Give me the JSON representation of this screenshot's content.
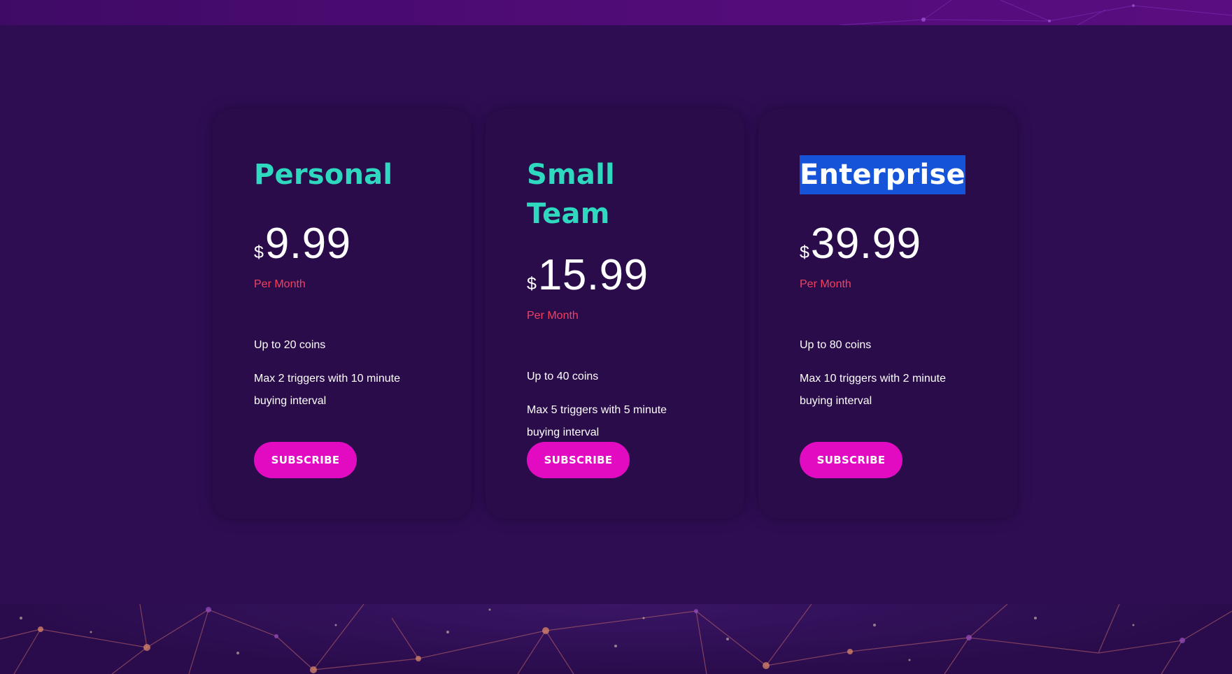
{
  "plans": [
    {
      "name": "Personal",
      "currency": "$",
      "price": "9.99",
      "period": "Per Month",
      "features": [
        "Up to 20 coins",
        "Max 2 triggers with 10 minute buying interval"
      ],
      "button": "SUBSCRIBE"
    },
    {
      "name": "Small Team",
      "currency": "$",
      "price": "15.99",
      "period": "Per Month",
      "features": [
        "Up to 40 coins",
        "Max 5 triggers with 5 minute buying interval"
      ],
      "button": "SUBSCRIBE"
    },
    {
      "name": "Enterprise",
      "currency": "$",
      "price": "39.99",
      "period": "Per Month",
      "features": [
        "Up to 80 coins",
        "Max 10 triggers with 2 minute buying interval"
      ],
      "button": "SUBSCRIBE",
      "selected": true
    }
  ],
  "colors": {
    "background": "#2f0d53",
    "card": "#2a0c4b",
    "plan_name": "#2ed9bf",
    "period": "#f2415f",
    "button": "#e30bc2",
    "selection": "#1553d8"
  }
}
